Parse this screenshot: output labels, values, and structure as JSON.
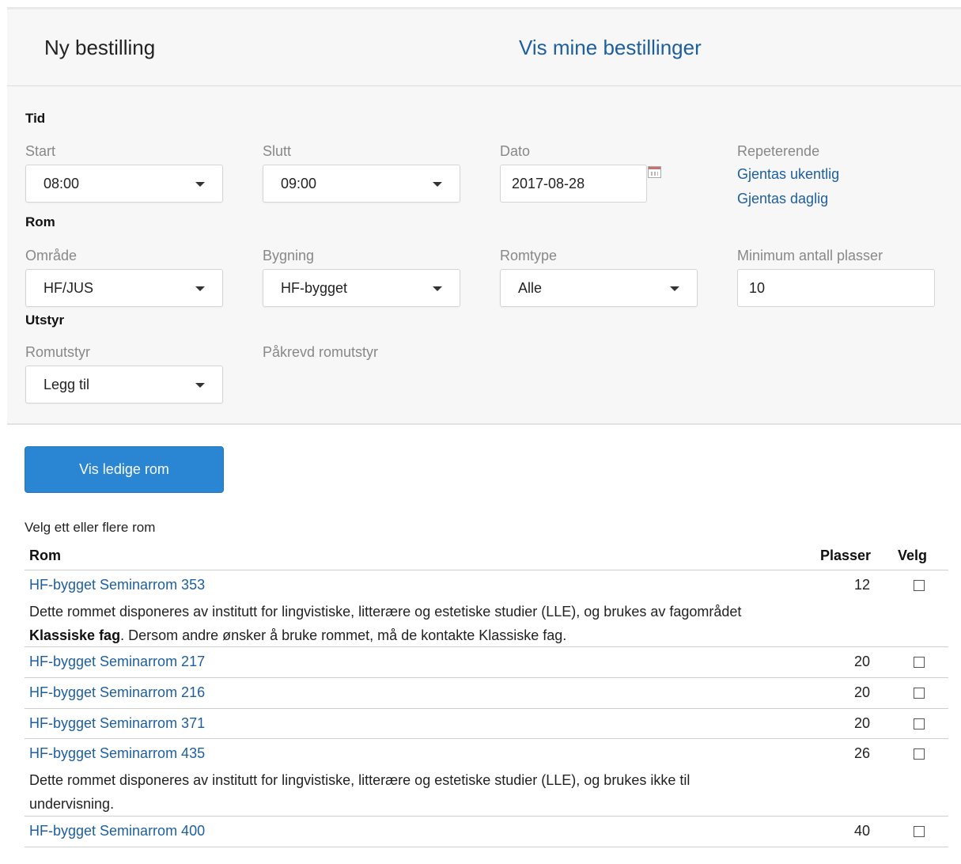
{
  "tabs": {
    "new_order": "Ny bestilling",
    "my_orders": "Vis mine bestillinger"
  },
  "time": {
    "heading": "Tid",
    "start_label": "Start",
    "start_value": "08:00",
    "end_label": "Slutt",
    "end_value": "09:00",
    "date_label": "Dato",
    "date_value": "2017-08-28",
    "repeat_label": "Repeterende",
    "repeat_weekly": "Gjentas ukentlig",
    "repeat_daily": "Gjentas daglig"
  },
  "room": {
    "heading": "Rom",
    "area_label": "Område",
    "area_value": "HF/JUS",
    "building_label": "Bygning",
    "building_value": "HF-bygget",
    "roomtype_label": "Romtype",
    "roomtype_value": "Alle",
    "min_seats_label": "Minimum antall plasser",
    "min_seats_value": "10"
  },
  "equipment": {
    "heading": "Utstyr",
    "equipment_label": "Romutstyr",
    "equipment_value": "Legg til",
    "required_label": "Påkrevd romutstyr"
  },
  "show_rooms_button": "Vis ledige rom",
  "choose_text": "Velg ett eller flere rom",
  "table": {
    "col_room": "Rom",
    "col_seats": "Plasser",
    "col_select": "Velg",
    "rows": [
      {
        "name": "HF-bygget Seminarrom 353",
        "seats": "12",
        "desc_pre": "Dette rommet disponeres av institutt for lingvistiske, litterære og estetiske studier (LLE), og brukes av fagområdet ",
        "desc_bold": "Klassiske fag",
        "desc_post": ". Dersom andre ønsker å bruke rommet, må de kontakte Klassiske fag."
      },
      {
        "name": "HF-bygget Seminarrom 217",
        "seats": "20"
      },
      {
        "name": "HF-bygget Seminarrom 216",
        "seats": "20"
      },
      {
        "name": "HF-bygget Seminarrom 371",
        "seats": "20"
      },
      {
        "name": "HF-bygget Seminarrom 435",
        "seats": "26",
        "desc_pre": "Dette rommet disponeres av institutt for lingvistiske, litterære og estetiske studier (LLE), og brukes ikke til undervisning."
      },
      {
        "name": "HF-bygget Seminarrom 400",
        "seats": "40"
      }
    ]
  },
  "icons": {
    "calendar": "calendar-icon",
    "dropdown": "chevron-down-icon",
    "checkbox": "checkbox-empty"
  },
  "colors": {
    "link": "#1d5f9e",
    "primary_button": "#2a86d2",
    "panel_bg": "#f7f7f7"
  }
}
